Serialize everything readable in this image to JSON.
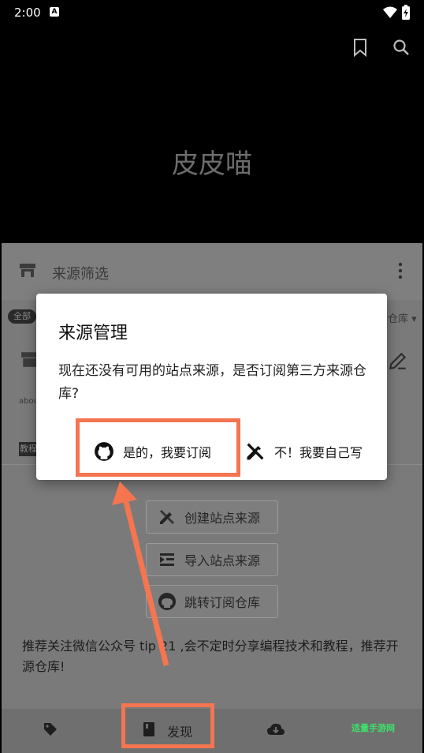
{
  "status_bar": {
    "time": "2:00",
    "notification_letter": "A"
  },
  "header": {
    "app_title": "皮皮喵",
    "icons": [
      "bookmark-icon",
      "search-icon"
    ]
  },
  "source_filter": {
    "title": "来源筛选",
    "chip_all": "全部",
    "repo_dropdown": "仓库",
    "about_text": "abou",
    "tutorial_chip": "教程"
  },
  "actions": [
    {
      "label": "创建站点来源",
      "icon": "pencil-ruler-icon"
    },
    {
      "label": "导入站点来源",
      "icon": "import-icon"
    },
    {
      "label": "跳转订阅仓库",
      "icon": "github-icon"
    }
  ],
  "recommend_text": "推荐关注微信公众号 tip 21 ,会不定时分享编程技术和教程，推荐开源仓库!",
  "dialog": {
    "title": "来源管理",
    "message": "现在还没有可用的站点来源，是否订阅第三方来源仓库?",
    "yes_label": "是的，我要订阅",
    "no_label": "不！我要自己写"
  },
  "bottom_nav": {
    "discover_label": "发现",
    "icons": [
      "tag-icon",
      "book-icon",
      "cloud-download-icon"
    ]
  },
  "watermark": "适量手游网",
  "colors": {
    "highlight": "#f4754f",
    "dialog_bg": "#ffffff",
    "dim_bg": "#7a7a7a"
  }
}
